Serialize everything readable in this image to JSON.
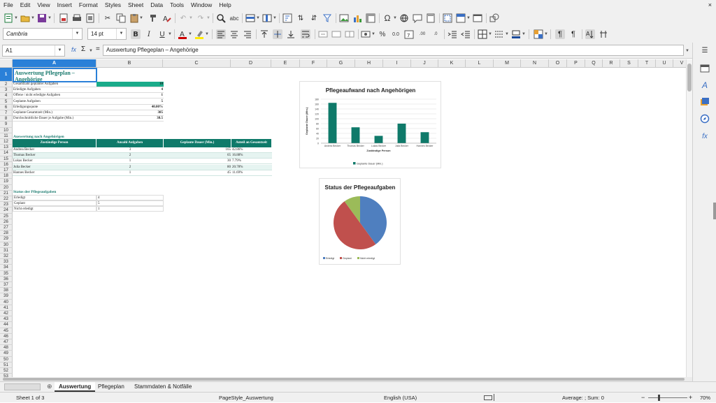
{
  "menu": [
    "File",
    "Edit",
    "View",
    "Insert",
    "Format",
    "Styles",
    "Sheet",
    "Data",
    "Tools",
    "Window",
    "Help"
  ],
  "window_close": "×",
  "font_name": "Cambria",
  "font_size": "14 pt",
  "name_box": "A1",
  "formula_content": "Auswertung Pflegeplan – Angehörige",
  "fx_symbol": "fx",
  "sum_symbol": "Σ",
  "equals_symbol": "=",
  "columns": [
    "A",
    "B",
    "C",
    "D",
    "E",
    "F",
    "G",
    "H",
    "I",
    "J",
    "K",
    "L",
    "M",
    "N",
    "O",
    "P",
    "Q",
    "R",
    "S",
    "T",
    "U",
    "V"
  ],
  "rows": [
    "1",
    "2",
    "3",
    "4",
    "5",
    "6",
    "7",
    "8",
    "9",
    "10",
    "11",
    "12",
    "13",
    "14",
    "15",
    "16",
    "17",
    "18",
    "19",
    "20",
    "21",
    "22",
    "23",
    "24",
    "25",
    "26",
    "27",
    "28",
    "29",
    "30",
    "31",
    "32",
    "33",
    "34",
    "35",
    "36",
    "37",
    "38",
    "39",
    "40",
    "41",
    "42",
    "43",
    "44",
    "45",
    "46",
    "47",
    "48",
    "49",
    "50",
    "51",
    "52",
    "53"
  ],
  "sheet": {
    "title": "Auswertung Pflegeplan – Angehörige",
    "summary": [
      {
        "label": "Gesamtzahl geplanter Aufgaben",
        "value": "10"
      },
      {
        "label": "Erledigte Aufgaben",
        "value": "4"
      },
      {
        "label": "Offene / nicht erledigte Aufgaben",
        "value": "1"
      },
      {
        "label": "Geplante Aufgaben",
        "value": "5"
      },
      {
        "label": "Erledigungsquote",
        "value": "40.00%"
      },
      {
        "label": "Geplante Gesamtzeit (Min.)",
        "value": "385"
      },
      {
        "label": "Durchschnittliche Dauer je Aufgabe (Min.)",
        "value": "38.5"
      }
    ],
    "section2_title": "Auswertung nach Angehörigen",
    "table_headers": [
      "Zuständige Person",
      "Anzahl Aufgaben",
      "Geplante Dauer (Min.)",
      "Anteil an Gesamtzeit"
    ],
    "table_rows": [
      [
        "Andrea Becker",
        "3",
        "165",
        "42.86%"
      ],
      [
        "Thomas Becker",
        "2",
        "65",
        "16.88%"
      ],
      [
        "Lukas Becker",
        "1",
        "30",
        "7.79%"
      ],
      [
        "Julia Becker",
        "2",
        "80",
        "20.78%"
      ],
      [
        "Hannes Becker",
        "1",
        "45",
        "11.69%"
      ]
    ],
    "section3_title": "Status der Pflegeaufgaben",
    "status_rows": [
      [
        "Erledigt",
        "4"
      ],
      [
        "Geplant",
        "5"
      ],
      [
        "Nicht erledigt",
        "1"
      ]
    ]
  },
  "chart_data": [
    {
      "type": "bar",
      "title": "Pflegeaufwand nach Angehörigen",
      "xlabel": "Zuständige Person",
      "ylabel": "Geplante Dauer (Min.)",
      "categories": [
        "Andrea Becker",
        "Thomas Becker",
        "Lukas Becker",
        "Julia Becker",
        "Hannes Becker"
      ],
      "series": [
        {
          "name": "Geplante Dauer (Min.)",
          "values": [
            165,
            65,
            30,
            80,
            45
          ]
        }
      ],
      "ylim": [
        0,
        180
      ],
      "yticks": [
        "0",
        "20",
        "40",
        "60",
        "80",
        "100",
        "120",
        "140",
        "160",
        "180"
      ],
      "grid": true,
      "legend": "bottom",
      "color": "#0f7a6a"
    },
    {
      "type": "pie",
      "title": "Status der Pflegeaufgaben",
      "categories": [
        "Erledigt",
        "Geplant",
        "Nicht erledigt"
      ],
      "values": [
        4,
        5,
        1
      ],
      "colors": [
        "#4f7fbf",
        "#c0504d",
        "#9bbb59"
      ],
      "legend": "bottom"
    }
  ],
  "tabs": {
    "nav_icon": "⊕",
    "items": [
      "Auswertung",
      "Pflegeplan",
      "Stammdaten & Notfälle"
    ],
    "active": "Auswertung"
  },
  "status": {
    "sheet": "Sheet 1 of 3",
    "page_style": "PageStyle_Auswertung",
    "language": "English (USA)",
    "summary": "Average: ; Sum: 0",
    "zoom": "70%"
  },
  "colors": {
    "accent": "#0f7a6a",
    "header_blue": "#2a80d8",
    "title_teal": "#1a7a6e"
  }
}
